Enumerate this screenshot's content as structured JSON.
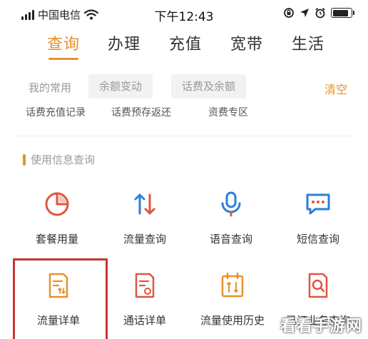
{
  "status_bar": {
    "carrier": "中国电信",
    "time": "下午12:43",
    "icons": [
      "signal-icon",
      "wifi-icon",
      "orientation-lock-icon",
      "location-icon",
      "alarm-icon",
      "battery-icon"
    ]
  },
  "tabs": [
    {
      "label": "查询",
      "active": true
    },
    {
      "label": "办理",
      "active": false
    },
    {
      "label": "充值",
      "active": false
    },
    {
      "label": "宽带",
      "active": false
    },
    {
      "label": "生活",
      "active": false
    }
  ],
  "frequent": {
    "label": "我的常用",
    "chips": [
      "余额变动",
      "话费及余额"
    ],
    "clear_label": "清空"
  },
  "partial_items": [
    "话费充值记录",
    "话费预存返还",
    "资费专区"
  ],
  "section": {
    "title": "使用信息查询"
  },
  "grid_row1": [
    {
      "label": "套餐用量",
      "icon": "pie-chart-icon"
    },
    {
      "label": "流量查询",
      "icon": "data-transfer-icon"
    },
    {
      "label": "语音查询",
      "icon": "microphone-icon"
    },
    {
      "label": "短信查询",
      "icon": "message-icon"
    }
  ],
  "grid_row2": [
    {
      "label": "流量详单",
      "icon": "data-bill-icon"
    },
    {
      "label": "通话详单",
      "icon": "call-bill-icon"
    },
    {
      "label": "流量使用历史",
      "icon": "calendar-history-icon"
    },
    {
      "label": "已订业务查询",
      "icon": "subscribed-service-icon"
    }
  ],
  "colors": {
    "accent": "#e8912a",
    "icon_red": "#e0553f",
    "icon_blue": "#2b7fd8",
    "highlight": "#c93434"
  },
  "watermark": "看看手游网"
}
